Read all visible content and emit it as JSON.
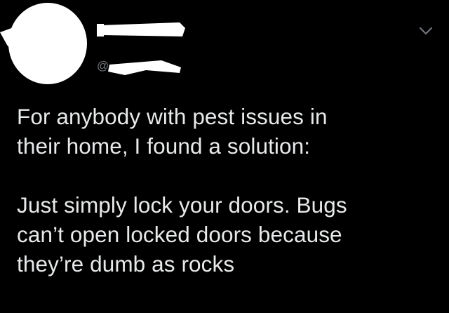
{
  "user": {
    "handle_prefix": "@"
  },
  "tweet": {
    "paragraph1": {
      "line1": "For anybody with pest issues in",
      "line2": "their home, I found a solution:"
    },
    "paragraph2": {
      "line1": "Just simply lock your doors. Bugs",
      "line2": "can’t open locked doors because",
      "line3": "they’re dumb as rocks"
    }
  },
  "icons": {
    "menu": "chevron-down-icon"
  },
  "colors": {
    "background": "#000000",
    "text": "#e7e9ea",
    "secondary_text": "#71767b",
    "redaction": "#ffffff"
  }
}
